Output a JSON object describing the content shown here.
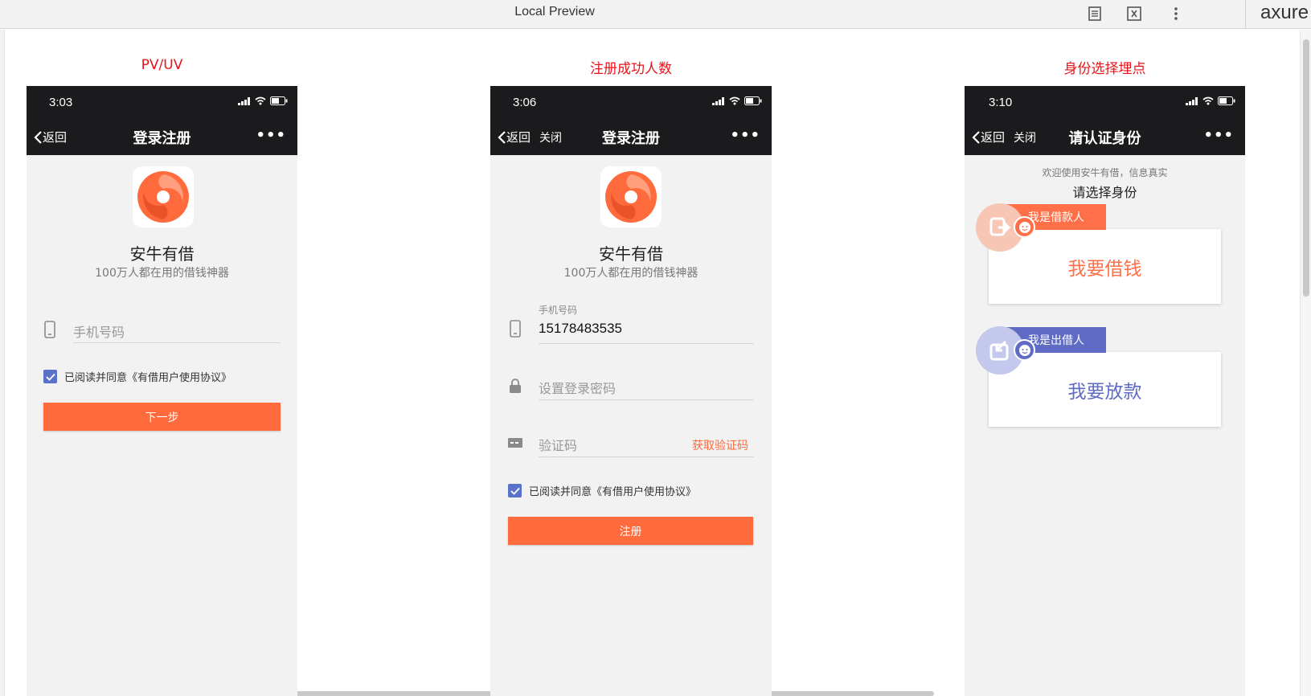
{
  "window": {
    "title": "Local Preview",
    "brand": "axure"
  },
  "frames": [
    {
      "caption": "PV/UV",
      "status": {
        "time": "3:03"
      },
      "nav": {
        "back": "返回",
        "title": "登录注册",
        "more": "•••"
      },
      "app": {
        "name": "安牛有借",
        "slogan": "100万人都在用的借钱神器"
      },
      "phone_field": {
        "placeholder": "手机号码"
      },
      "agreement": {
        "prefix": "已阅读并同意",
        "link": "《有借用户使用协议》"
      },
      "button": "下一步"
    },
    {
      "caption": "注册成功人数",
      "status": {
        "time": "3:06"
      },
      "nav": {
        "back": "返回",
        "close": "关闭",
        "title": "登录注册",
        "more": "•••"
      },
      "app": {
        "name": "安牛有借",
        "slogan": "100万人都在用的借钱神器"
      },
      "phone_field": {
        "label": "手机号码",
        "value": "15178483535"
      },
      "password_field": {
        "placeholder": "设置登录密码"
      },
      "code_field": {
        "placeholder": "验证码",
        "action": "获取验证码"
      },
      "agreement": {
        "prefix": "已阅读并同意",
        "link": "《有借用户使用协议》"
      },
      "button": "注册"
    },
    {
      "caption": "身份选择埋点",
      "status": {
        "time": "3:10"
      },
      "nav": {
        "back": "返回",
        "close": "关闭",
        "title": "请认证身份",
        "more": "•••"
      },
      "welcome": "欢迎使用安牛有借，信息真实",
      "choose": "请选择身份",
      "roles": [
        {
          "tag": "我是借款人",
          "action": "我要借钱",
          "color": "#ff6f48",
          "bubble": "#f7c6b4"
        },
        {
          "tag": "我是出借人",
          "action": "我要放款",
          "color": "#5f6bc4",
          "bubble": "#c3c8ec"
        }
      ]
    }
  ],
  "colors": {
    "accent": "#ff6b3d",
    "caption_red": "#e8131a",
    "checkbox": "#5b72c9",
    "dark_bar": "#1b1b1d"
  },
  "icons": [
    "document-icon",
    "code-icon",
    "more-vertical-icon",
    "signal-icon",
    "wifi-icon",
    "battery-icon",
    "chevron-left-icon",
    "mobile-icon",
    "lock-icon",
    "card-icon",
    "check-icon",
    "app-logo-icon",
    "borrow-icon",
    "lend-icon",
    "face-icon"
  ]
}
